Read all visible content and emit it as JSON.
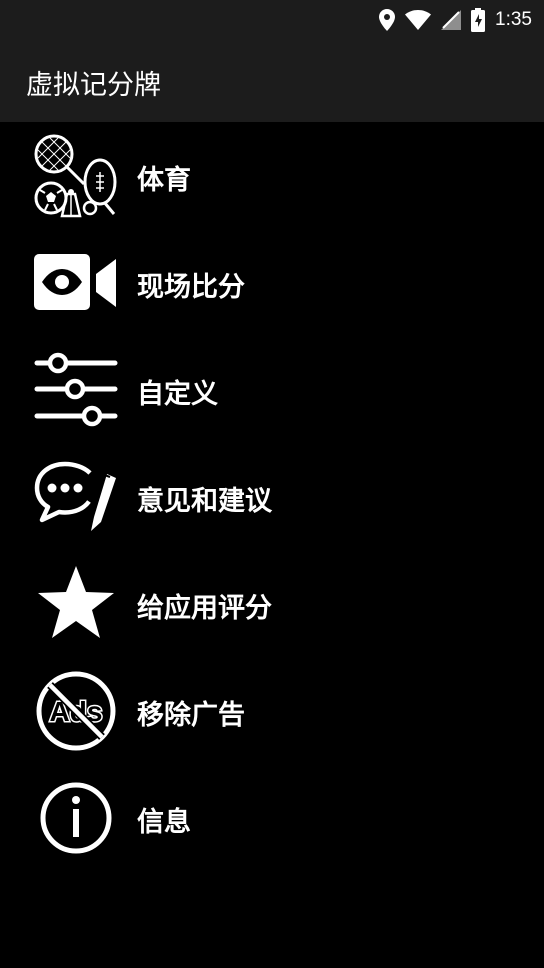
{
  "status_bar": {
    "time": "1:35",
    "icons": [
      "location-icon",
      "wifi-icon",
      "no-sim-icon",
      "battery-icon"
    ]
  },
  "app_bar": {
    "title": "虚拟记分牌"
  },
  "menu": {
    "items": [
      {
        "icon": "sports-equipment-icon",
        "label": "体育"
      },
      {
        "icon": "live-video-icon",
        "label": "现场比分"
      },
      {
        "icon": "sliders-icon",
        "label": "自定义"
      },
      {
        "icon": "feedback-chat-pencil-icon",
        "label": "意见和建议"
      },
      {
        "icon": "star-icon",
        "label": "给应用评分"
      },
      {
        "icon": "no-ads-icon",
        "label": "移除广告",
        "icon_text": "Ads"
      },
      {
        "icon": "info-icon",
        "label": "信息"
      }
    ]
  },
  "colors": {
    "background": "#000000",
    "app_bar": "#1c1c1c",
    "text": "#ffffff"
  }
}
